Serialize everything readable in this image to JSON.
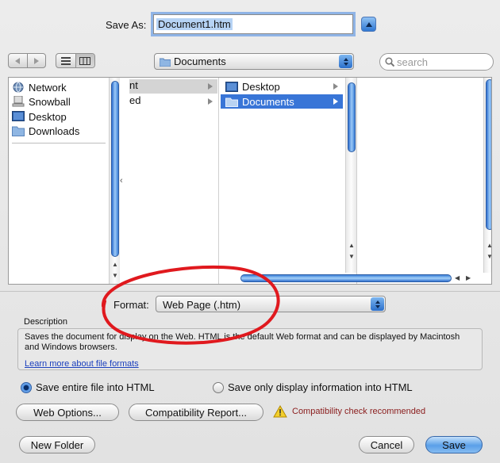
{
  "dialog": {
    "save_as_label": "Save As:",
    "filename": "Document1.htm"
  },
  "toolbar": {
    "location": "Documents",
    "search_placeholder": "search"
  },
  "sidebar": {
    "items": [
      {
        "label": "Network",
        "icon": "globe-icon"
      },
      {
        "label": "Snowball",
        "icon": "computer-icon"
      },
      {
        "label": "Desktop",
        "icon": "desktop-icon"
      },
      {
        "label": "Downloads",
        "icon": "folder-icon"
      }
    ]
  },
  "browser": {
    "column1": [
      "nt",
      "ed"
    ],
    "column2": [
      {
        "label": "Desktop",
        "icon": "desktop-icon",
        "selected": false
      },
      {
        "label": "Documents",
        "icon": "folder-icon",
        "selected": true
      }
    ]
  },
  "format": {
    "label": "Format:",
    "value": "Web Page (.htm)"
  },
  "description": {
    "title": "Description",
    "text": "Saves the document for display on the Web. HTML is the default Web format and can be displayed by Macintosh and Windows browsers.",
    "link": "Learn more about file formats"
  },
  "options": {
    "radio_entire": "Save entire file into HTML",
    "radio_display": "Save only display information into HTML",
    "selected": "radio_entire",
    "web_options": "Web Options...",
    "compat_report": "Compatibility Report...",
    "compat_warning": "Compatibility check recommended"
  },
  "footer": {
    "new_folder": "New Folder",
    "cancel": "Cancel",
    "save": "Save"
  },
  "colors": {
    "accent": "#3875d7",
    "annotation": "#e0191e",
    "warning_text": "#8a1c1c"
  }
}
